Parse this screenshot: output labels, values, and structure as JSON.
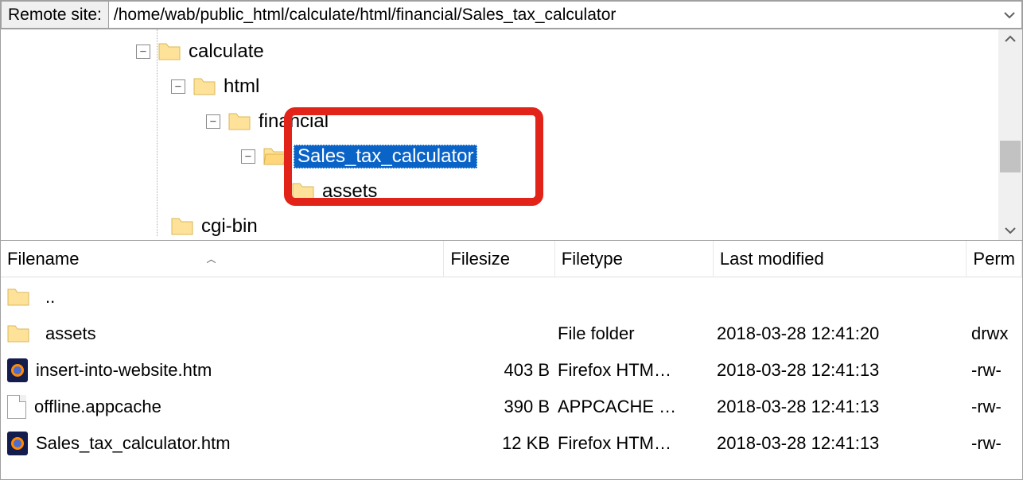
{
  "path_bar": {
    "label": "Remote site:",
    "value": "/home/wab/public_html/calculate/html/financial/Sales_tax_calculator"
  },
  "tree": {
    "nodes": [
      {
        "label": "calculate",
        "expander": "−",
        "indent": 0
      },
      {
        "label": "html",
        "expander": "−",
        "indent": 1
      },
      {
        "label": "financial",
        "expander": "−",
        "indent": 2
      },
      {
        "label": "Sales_tax_calculator",
        "expander": "−",
        "indent": 3,
        "selected": true
      },
      {
        "label": "assets",
        "expander": "",
        "indent": 4
      },
      {
        "label": "cgi-bin",
        "expander": "",
        "indent": 1
      }
    ]
  },
  "columns": {
    "name": "Filename",
    "size": "Filesize",
    "type": "Filetype",
    "modified": "Last modified",
    "perm": "Perm"
  },
  "files": [
    {
      "icon": "folder",
      "name": "..",
      "size": "",
      "type": "",
      "modified": "",
      "perm": ""
    },
    {
      "icon": "folder",
      "name": "assets",
      "size": "",
      "type": "File folder",
      "modified": "2018-03-28 12:41:20",
      "perm": "drwx"
    },
    {
      "icon": "firefox",
      "name": "insert-into-website.htm",
      "size": "403 B",
      "type": "Firefox HTM…",
      "modified": "2018-03-28 12:41:13",
      "perm": "-rw-"
    },
    {
      "icon": "file",
      "name": "offline.appcache",
      "size": "390 B",
      "type": "APPCACHE …",
      "modified": "2018-03-28 12:41:13",
      "perm": "-rw-"
    },
    {
      "icon": "firefox",
      "name": "Sales_tax_calculator.htm",
      "size": "12 KB",
      "type": "Firefox HTM…",
      "modified": "2018-03-28 12:41:13",
      "perm": "-rw-"
    }
  ],
  "annotation": {
    "present": true
  }
}
